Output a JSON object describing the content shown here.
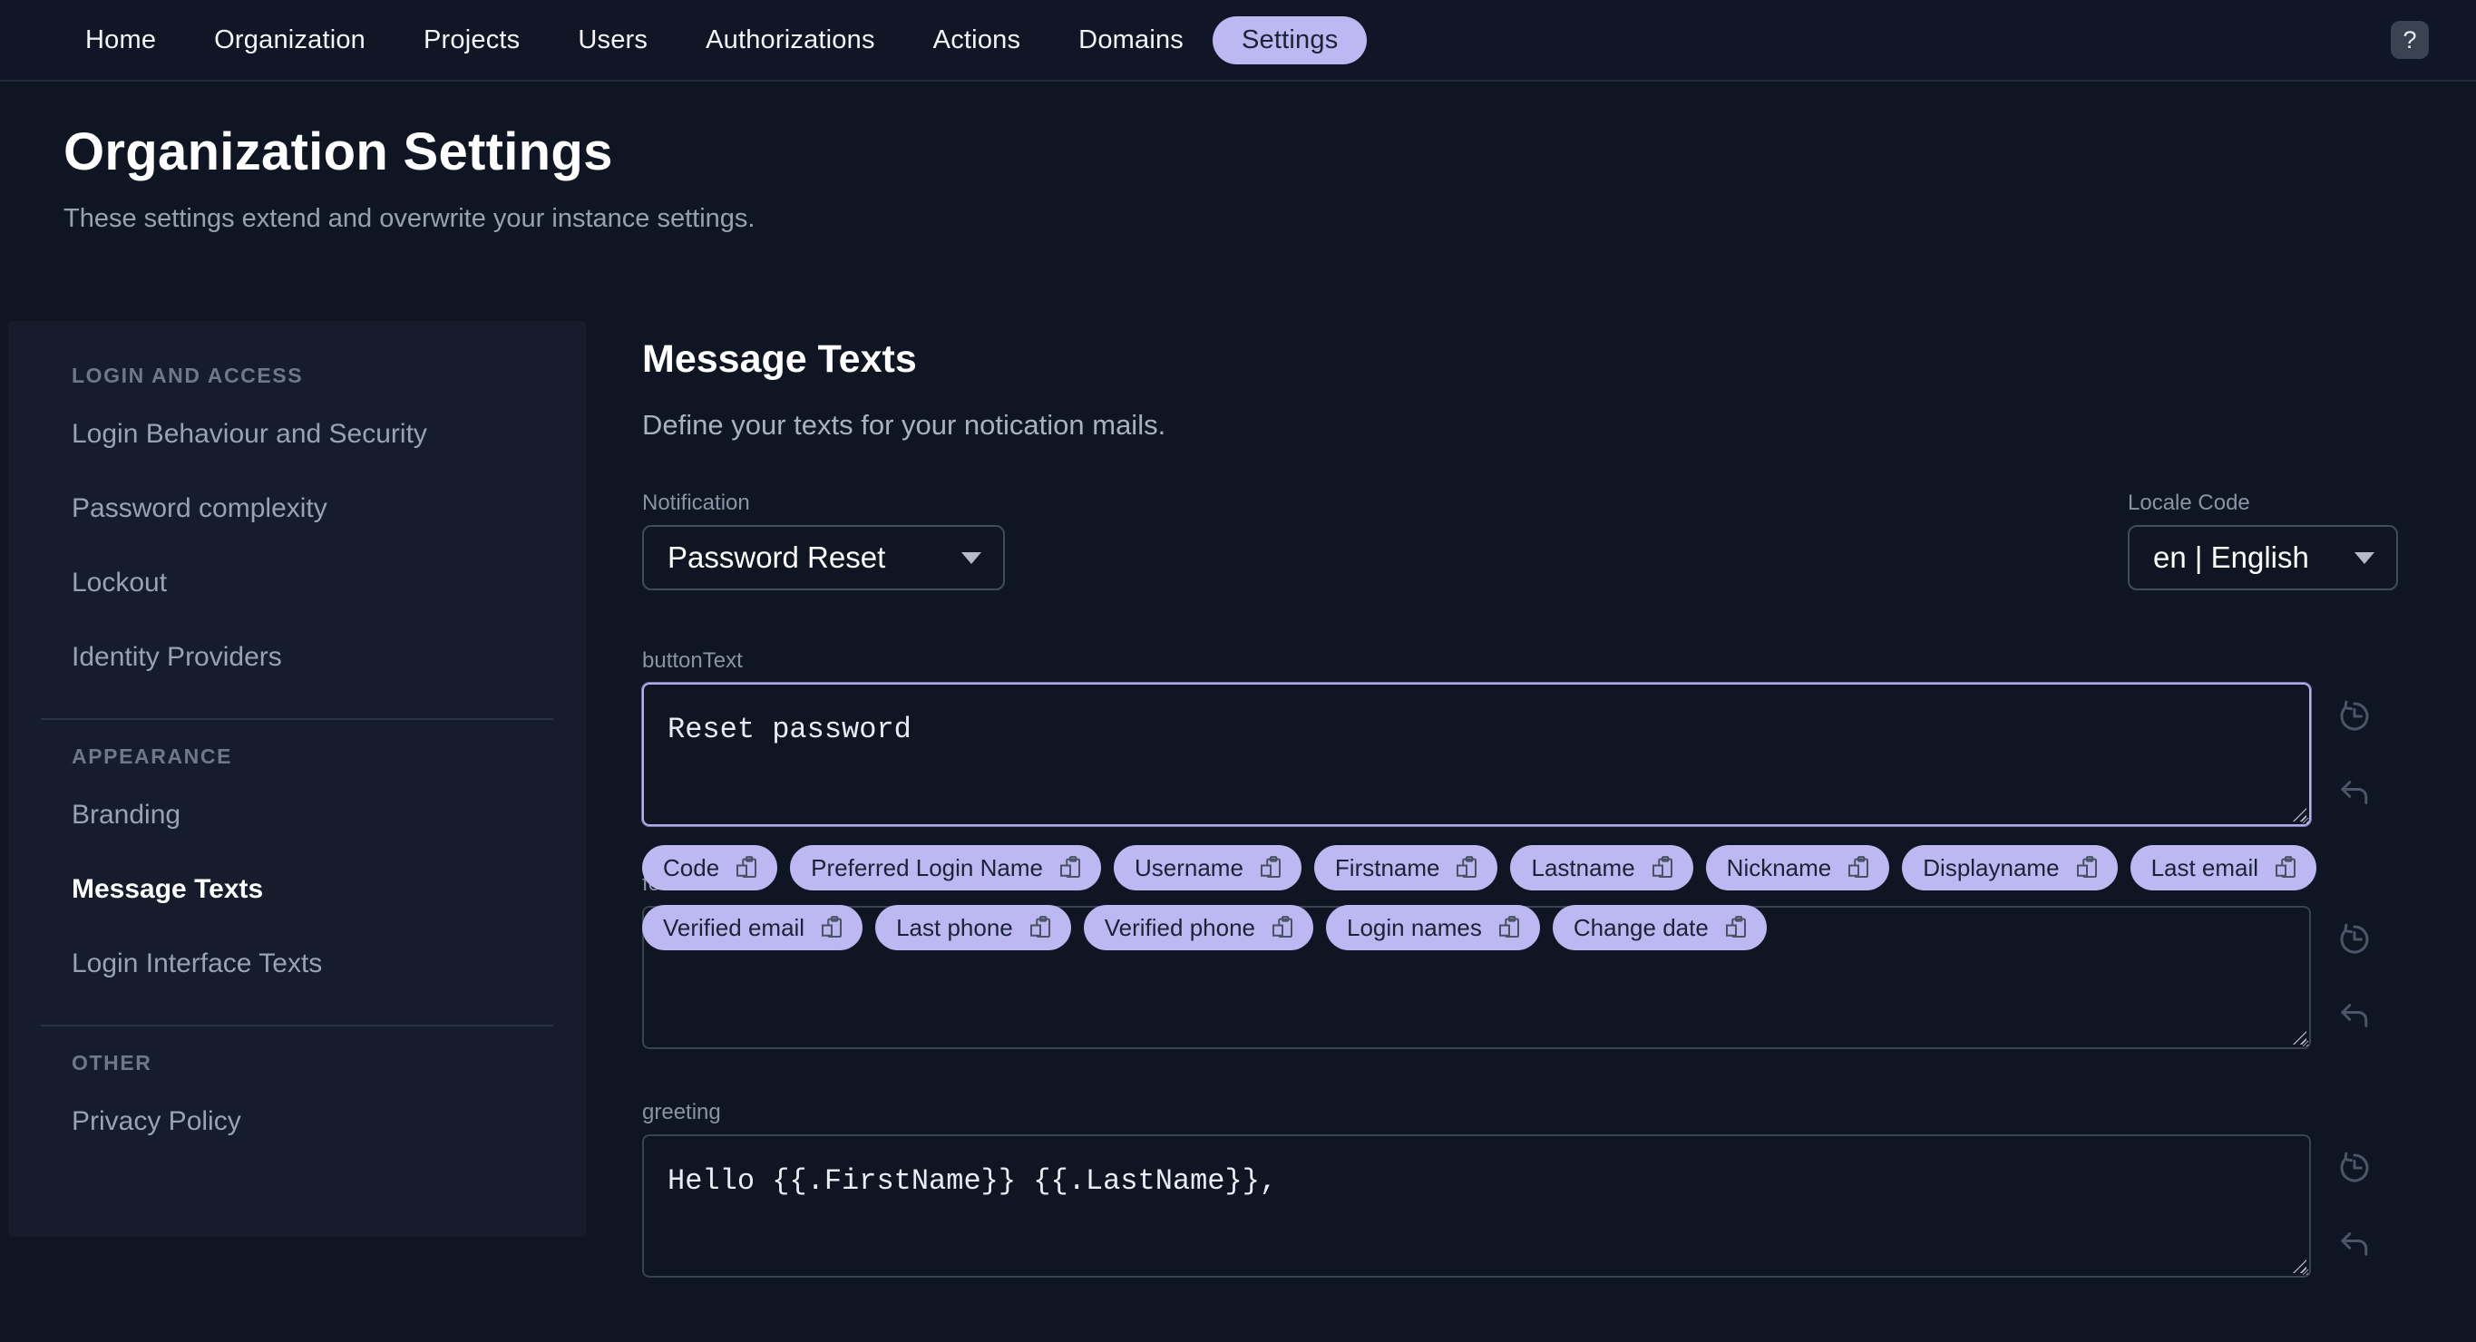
{
  "nav": {
    "items": [
      "Home",
      "Organization",
      "Projects",
      "Users",
      "Authorizations",
      "Actions",
      "Domains",
      "Settings"
    ],
    "active_item": "Settings",
    "help": "?"
  },
  "page": {
    "title": "Organization Settings",
    "subtitle": "These settings extend and overwrite your instance settings."
  },
  "sidebar": {
    "sections": [
      {
        "heading": "LOGIN AND ACCESS",
        "items": [
          {
            "label": "Login Behaviour and Security"
          },
          {
            "label": "Password complexity"
          },
          {
            "label": "Lockout"
          },
          {
            "label": "Identity Providers"
          }
        ]
      },
      {
        "heading": "APPEARANCE",
        "items": [
          {
            "label": "Branding"
          },
          {
            "label": "Message Texts",
            "active": true
          },
          {
            "label": "Login Interface Texts"
          }
        ]
      },
      {
        "heading": "OTHER",
        "items": [
          {
            "label": "Privacy Policy"
          }
        ]
      }
    ]
  },
  "main": {
    "title": "Message Texts",
    "subtitle": "Define your texts for your notication mails.",
    "notification_select": {
      "label": "Notification",
      "value": "Password Reset"
    },
    "locale_select": {
      "label": "Locale Code",
      "value": "en | English"
    },
    "button_text_field": {
      "label": "buttonText",
      "value": "Reset password"
    },
    "footer_text_field": {
      "label": "footerText",
      "value": ""
    },
    "greeting_field": {
      "label": "greeting",
      "value": "Hello {{.FirstName}} {{.LastName}},"
    },
    "placeholder_chips": [
      "Code",
      "Preferred Login Name",
      "Username",
      "Firstname",
      "Lastname",
      "Nickname",
      "Displayname",
      "Last email",
      "Verified email",
      "Last phone",
      "Verified phone",
      "Login names",
      "Change date"
    ]
  },
  "colors": {
    "accent": "#bdb7f2",
    "accent_text": "#1b2336",
    "focus_border": "#b2acee",
    "page_bg": "#101524",
    "sidebar_bg": "#161c2b"
  }
}
